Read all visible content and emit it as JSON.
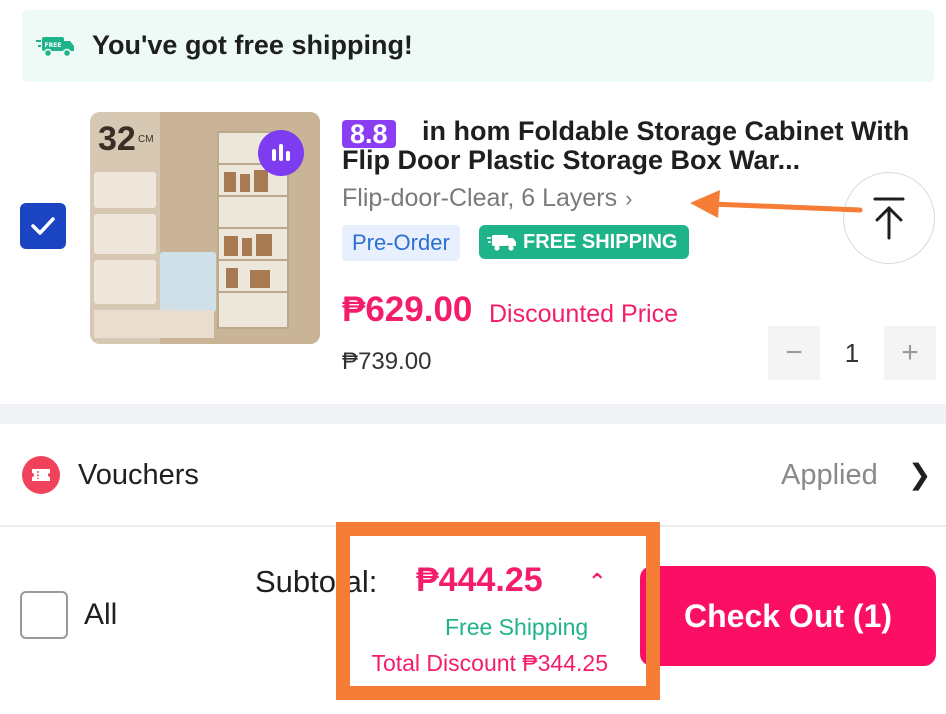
{
  "banner": {
    "icon": "free-shipping-truck-icon",
    "icon_text": "FREE",
    "text": "You've got free shipping!"
  },
  "product": {
    "checked": true,
    "thumbnail": {
      "size_text": "32",
      "unit_text": "CM"
    },
    "sale_tag": "8.8",
    "title": "in hom Foldable Storage Cabinet With Flip Door Plastic Storage Box War...",
    "variant": "Flip-door-Clear, 6 Layers",
    "tags": {
      "preorder": "Pre-Order",
      "free_shipping": "FREE SHIPPING"
    },
    "price": "₱629.00",
    "price_label": "Discounted Price",
    "original_price": "₱739.00",
    "quantity": "1",
    "decrement_symbol": "−",
    "increment_symbol": "+"
  },
  "vouchers": {
    "label": "Vouchers",
    "status": "Applied"
  },
  "footer": {
    "select_all_label": "All",
    "subtotal_label": "Subtotal:",
    "subtotal_value": "₱444.25",
    "free_shipping": "Free Shipping",
    "total_discount": "Total Discount ₱344.25",
    "checkout_label": "Check Out (1)"
  },
  "colors": {
    "accent_pink": "#f41d6b",
    "checkout_bg": "#fb0f64",
    "green": "#1fb38a",
    "checkbox_blue": "#1a44c2",
    "annotation_orange": "#f57d36"
  }
}
